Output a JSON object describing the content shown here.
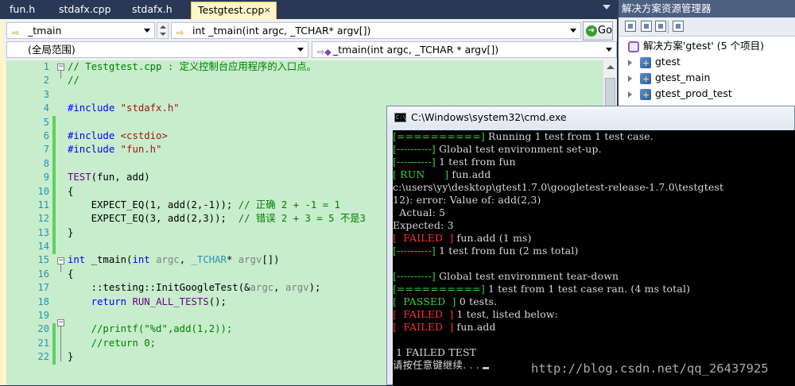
{
  "tabs": [
    {
      "label": "fun.h"
    },
    {
      "label": "stdafx.cpp"
    },
    {
      "label": "stdafx.h"
    },
    {
      "label": "Testgtest.cpp",
      "close": "×"
    }
  ],
  "navbar": {
    "scope_combo": "_tmain",
    "function_combo": "int _tmain(int argc, _TCHAR* argv[])",
    "go_label": "Go",
    "project_combo": "(全局范围)",
    "member_combo": "_tmain(int argc, _TCHAR * argv[])"
  },
  "editor": {
    "line_numbers": [
      "1",
      "2",
      "3",
      "4",
      "5",
      "6",
      "7",
      "8",
      "9",
      "10",
      "11",
      "12",
      "13",
      "14",
      "15",
      "16",
      "17",
      "18",
      "19",
      "20",
      "21",
      "22"
    ],
    "fold_markers": {
      "minus": "−"
    }
  },
  "solution_explorer": {
    "title": "解决方案资源管理器",
    "solution_label": "解决方案'gtest' (5 个项目)",
    "projects": [
      "gtest",
      "gtest_main",
      "gtest_prod_test"
    ]
  },
  "console": {
    "title": "C:\\Windows\\system32\\cmd.exe",
    "icon_text": "C:\\",
    "lines": [
      {
        "tag": "[==========]",
        "text": " Running 1 test from 1 test case."
      },
      {
        "tag": "[----------]",
        "text": " Global test environment set-up."
      },
      {
        "tag": "[----------]",
        "text": " 1 test from fun"
      },
      {
        "tag": "[ RUN      ]",
        "text": " fun.add"
      },
      {
        "text": "c:\\users\\yy\\desktop\\gtest1.7.0\\googletest-release-1.7.0\\testgtest"
      },
      {
        "text": "12): error: Value of: add(2,3)"
      },
      {
        "text": "  Actual: 5"
      },
      {
        "text": "Expected: 3"
      },
      {
        "tag_red": "[  FAILED  ]",
        "text": " fun.add (1 ms)"
      },
      {
        "tag": "[----------]",
        "text": " 1 test from fun (2 ms total)"
      },
      {
        "text": ""
      },
      {
        "tag": "[----------]",
        "text": " Global test environment tear-down"
      },
      {
        "tag": "[==========]",
        "text": " 1 test from 1 test case ran. (4 ms total)"
      },
      {
        "tag": "[  PASSED  ]",
        "text": " 0 tests."
      },
      {
        "tag_red": "[  FAILED  ]",
        "text": " 1 test, listed below:"
      },
      {
        "tag_red": "[  FAILED  ]",
        "text": " fun.add"
      },
      {
        "text": ""
      },
      {
        "text": " 1 FAILED TEST"
      },
      {
        "text": "请按任意键继续. . ."
      }
    ]
  },
  "watermark": "http://blog.csdn.net/qq_26437925",
  "colors": {
    "editor_bg": "#c7edcc",
    "ide_frame": "#293955",
    "console_green": "#3bd13b",
    "console_red": "#ff3030"
  },
  "icons": [
    "arrow-right-icon",
    "go-icon",
    "project-icon",
    "solution-icon",
    "console-icon"
  ]
}
